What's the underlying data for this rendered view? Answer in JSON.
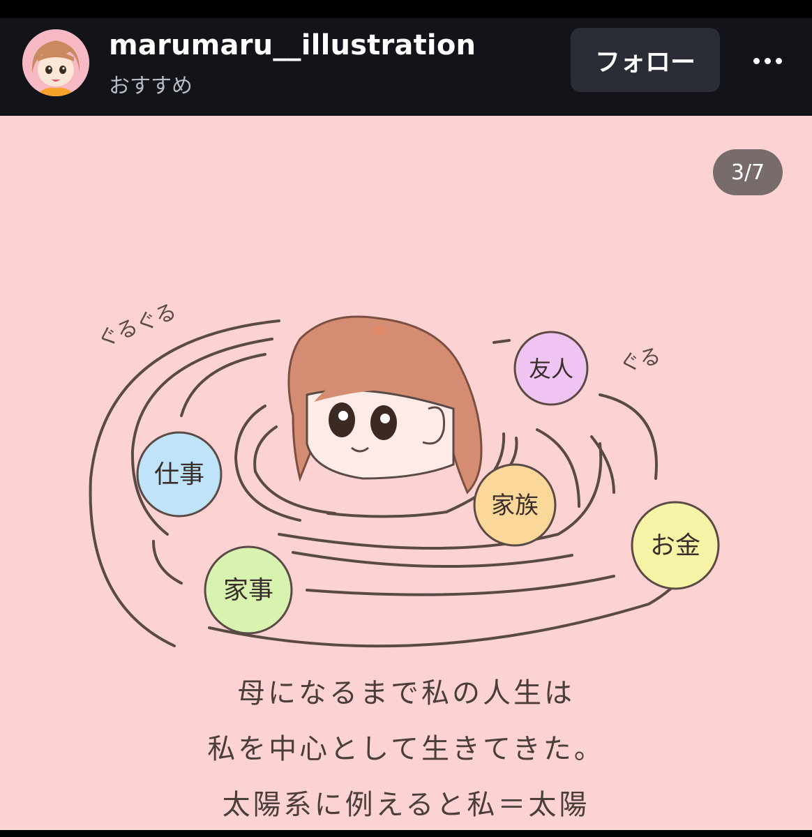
{
  "header": {
    "username": "marumaru__illustration",
    "subtitle": "おすすめ",
    "follow_label": "フォロー",
    "more_icon": "more-horizontal-icon"
  },
  "post": {
    "counter": "3/7",
    "sfx_left": "ぐるぐる",
    "sfx_right": "ぐる",
    "planets": {
      "friends": "友人",
      "work": "仕事",
      "family": "家族",
      "housework": "家事",
      "money": "お金"
    },
    "caption": [
      "母になるまで私の人生は",
      "私を中心として生きてきた。",
      "太陽系に例えると私＝太陽"
    ]
  },
  "colors": {
    "header_bg": "#12141a",
    "post_bg": "#fcd2d2",
    "follow_bg": "#2a2d35",
    "counter_bg": "#786b6c"
  }
}
